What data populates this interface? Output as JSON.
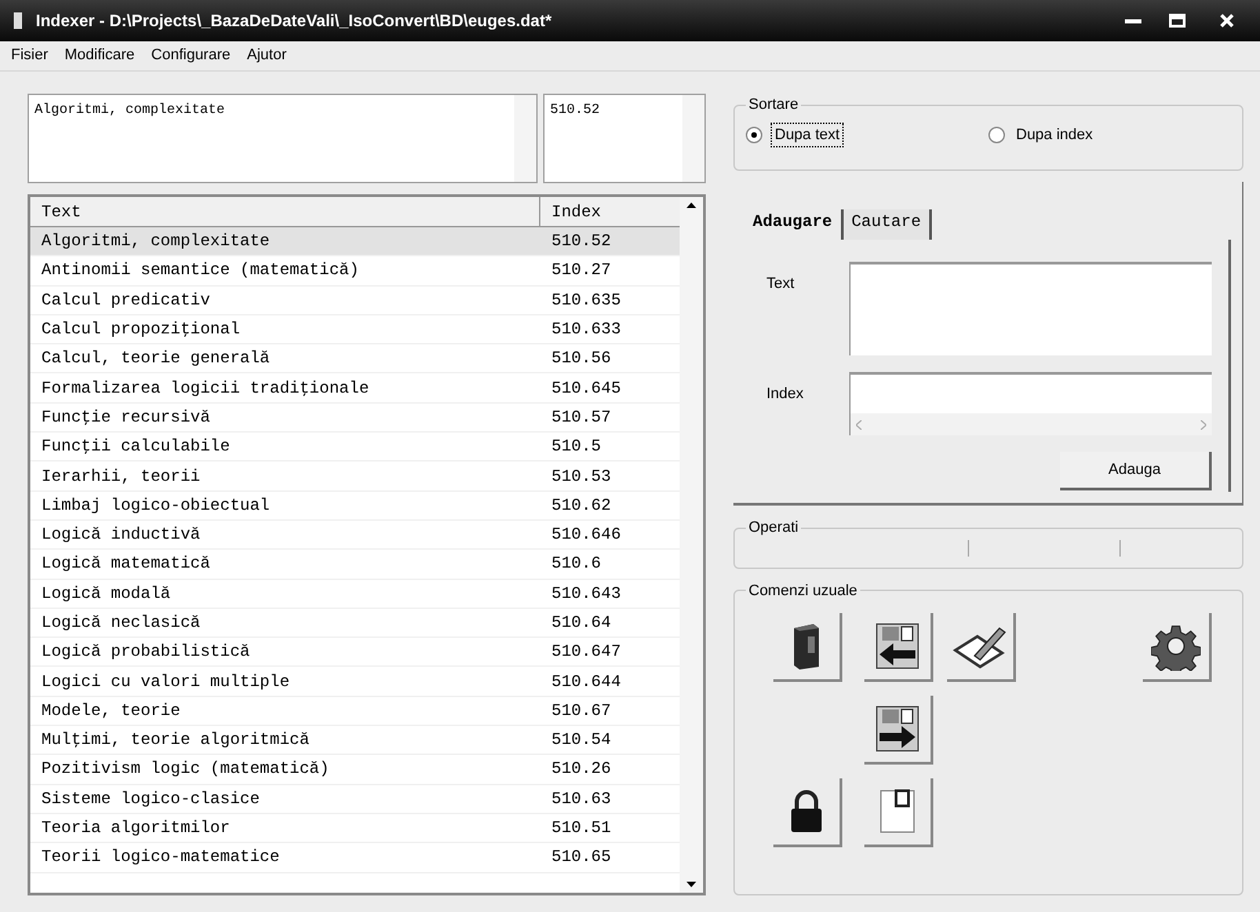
{
  "window": {
    "title": "Indexer - D:\\Projects\\_BazaDeDateVali\\_IsoConvert\\BD\\euges.dat*"
  },
  "menu": [
    "Fisier",
    "Modificare",
    "Configurare",
    "Ajutor"
  ],
  "current": {
    "text": "Algoritmi, complexitate",
    "index": "510.52"
  },
  "table": {
    "columns": [
      "Text",
      "Index"
    ],
    "rows": [
      {
        "text": "Algoritmi, complexitate",
        "index": "510.52",
        "selected": true
      },
      {
        "text": "Antinomii semantice (matematică)",
        "index": "510.27",
        "selected": false
      },
      {
        "text": "Calcul predicativ",
        "index": "510.635",
        "selected": false
      },
      {
        "text": "Calcul propoziţional",
        "index": "510.633",
        "selected": false
      },
      {
        "text": "Calcul, teorie generală",
        "index": "510.56",
        "selected": false
      },
      {
        "text": "Formalizarea logicii tradiţionale",
        "index": "510.645",
        "selected": false
      },
      {
        "text": "Funcţie recursivă",
        "index": "510.57",
        "selected": false
      },
      {
        "text": "Funcţii calculabile",
        "index": "510.5",
        "selected": false
      },
      {
        "text": "Ierarhii, teorii",
        "index": "510.53",
        "selected": false
      },
      {
        "text": "Limbaj logico-obiectual",
        "index": "510.62",
        "selected": false
      },
      {
        "text": "Logică inductivă",
        "index": "510.646",
        "selected": false
      },
      {
        "text": "Logică matematică",
        "index": "510.6",
        "selected": false
      },
      {
        "text": "Logică modală",
        "index": "510.643",
        "selected": false
      },
      {
        "text": "Logică neclasică",
        "index": "510.64",
        "selected": false
      },
      {
        "text": "Logică probabilistică",
        "index": "510.647",
        "selected": false
      },
      {
        "text": "Logici cu valori multiple",
        "index": "510.644",
        "selected": false
      },
      {
        "text": "Modele, teorie",
        "index": "510.67",
        "selected": false
      },
      {
        "text": "Mulţimi, teorie algoritmică",
        "index": "510.54",
        "selected": false
      },
      {
        "text": "Pozitivism logic (matematică)",
        "index": "510.26",
        "selected": false
      },
      {
        "text": "Sisteme logico-clasice",
        "index": "510.63",
        "selected": false
      },
      {
        "text": "Teoria algoritmilor",
        "index": "510.51",
        "selected": false
      },
      {
        "text": "Teorii logico-matematice",
        "index": "510.65",
        "selected": false
      }
    ]
  },
  "sort": {
    "title": "Sortare",
    "options": [
      {
        "label": "Dupa text",
        "selected": true
      },
      {
        "label": "Dupa index",
        "selected": false
      }
    ]
  },
  "tabs": [
    {
      "label": "Adaugare",
      "selected": true
    },
    {
      "label": "Cautare",
      "selected": false
    }
  ],
  "add_form": {
    "text_label": "Text",
    "index_label": "Index",
    "button": "Adauga"
  },
  "operations": {
    "title": "Operati"
  },
  "commands": {
    "title": "Comenzi uzuale",
    "buttons": [
      {
        "kind": "book"
      },
      {
        "kind": "import"
      },
      {
        "kind": "edit"
      },
      {
        "kind": "settings"
      },
      {
        "kind": "export"
      },
      {
        "kind": "lock"
      },
      {
        "kind": "page"
      }
    ]
  }
}
